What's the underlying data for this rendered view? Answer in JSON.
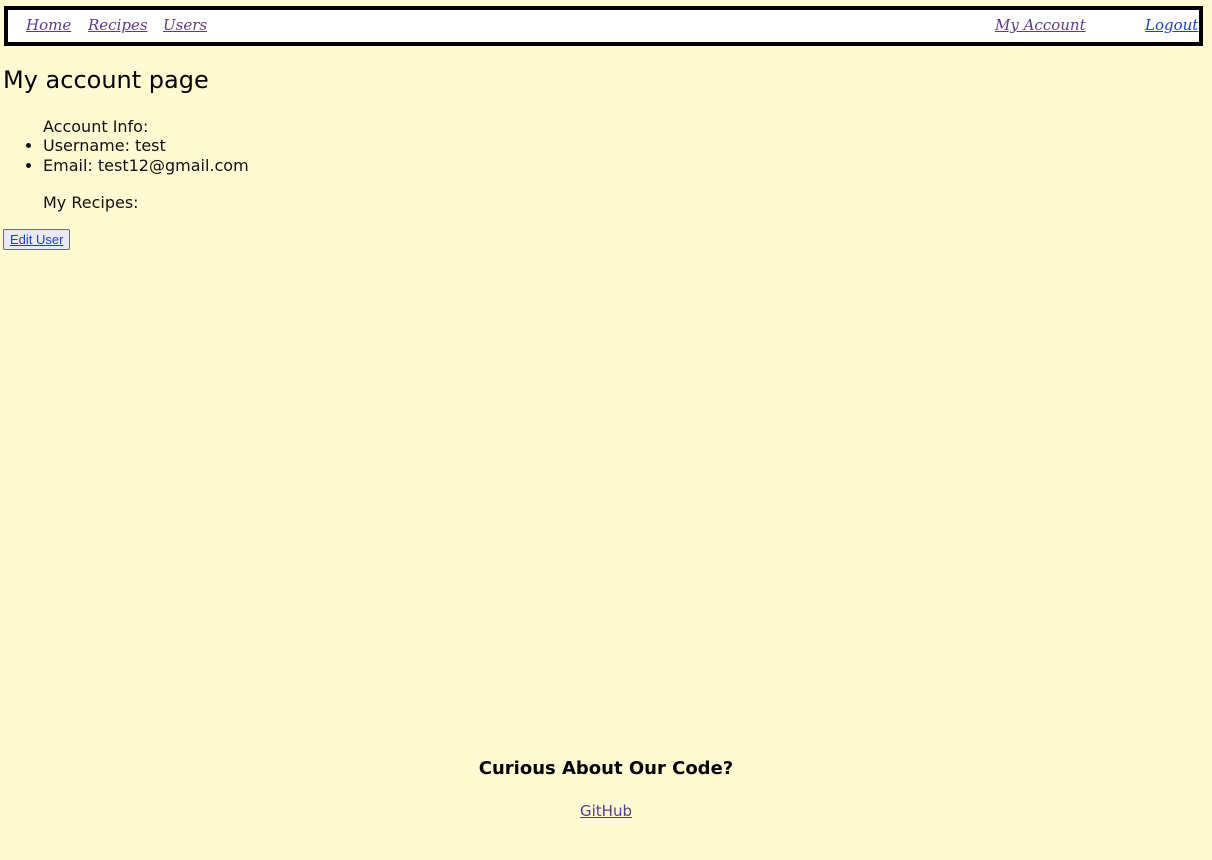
{
  "nav": {
    "home": "Home",
    "recipes": "Recipes",
    "users": "Users",
    "my_account": "My Account",
    "logout": "Logout"
  },
  "main": {
    "title": "My account page",
    "account_info_label": "Account Info:",
    "username": "Username: test",
    "email": "Email: test12@gmail.com",
    "my_recipes_label": "My Recipes:",
    "edit_button": "Edit User"
  },
  "footer": {
    "title": "Curious About Our Code?",
    "link": "GitHub"
  },
  "colors": {
    "background": "#fffad1",
    "visited_link": "#5b3b8c",
    "link": "#1d3fd1"
  }
}
